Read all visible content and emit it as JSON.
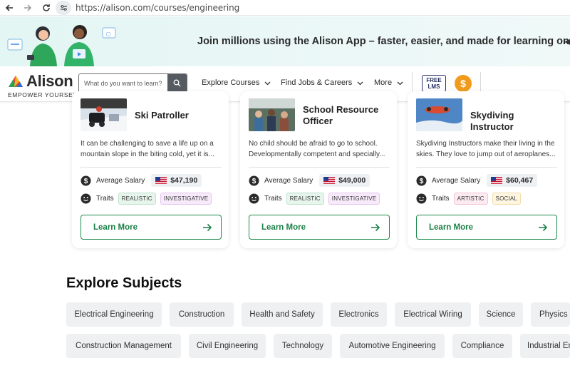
{
  "browser": {
    "url": "https://alison.com/courses/engineering"
  },
  "promo": {
    "text": "Join millions using the Alison App – faster, easier, and made for learning on the move..."
  },
  "header": {
    "logo_word": "Alison",
    "logo_tagline": "EMPOWER YOURSELF",
    "search_placeholder": "What do you want to learn?",
    "menu": [
      "Explore Courses",
      "Find Jobs & Careers",
      "More"
    ],
    "free_lms_line1": "FREE",
    "free_lms_line2": "LMS",
    "coin_symbol": "$"
  },
  "cards": [
    {
      "title": "Ski Patroller",
      "description": "It can be challenging to save a life up on a mountain slope in the biting cold, yet it is...",
      "salary_label": "Average Salary",
      "salary": "$47,190",
      "traits_label": "Traits",
      "traits": [
        "REALISTIC",
        "INVESTIGATIVE"
      ],
      "button": "Learn More"
    },
    {
      "title": "School Resource Officer",
      "description": "No child should be afraid to go to school. Developmentally competent and specially...",
      "salary_label": "Average Salary",
      "salary": "$49,000",
      "traits_label": "Traits",
      "traits": [
        "REALISTIC",
        "INVESTIGATIVE"
      ],
      "button": "Learn More"
    },
    {
      "title": "Skydiving Instructor",
      "description": "Skydiving Instructors make their living in the skies. They love to jump out of aeroplanes...",
      "salary_label": "Average Salary",
      "salary": "$60,467",
      "traits_label": "Traits",
      "traits": [
        "ARTISTIC",
        "SOCIAL"
      ],
      "button": "Learn More"
    }
  ],
  "subjects": {
    "title": "Explore Subjects",
    "row1": [
      "Electrical Engineering",
      "Construction",
      "Health and Safety",
      "Electronics",
      "Electrical Wiring",
      "Science",
      "Physics"
    ],
    "row2": [
      "Construction Management",
      "Civil Engineering",
      "Technology",
      "Automotive Engineering",
      "Compliance",
      "Industrial Engineering"
    ]
  },
  "colors": {
    "accent_green": "#1a7f45",
    "coin_orange": "#f19b1d"
  }
}
